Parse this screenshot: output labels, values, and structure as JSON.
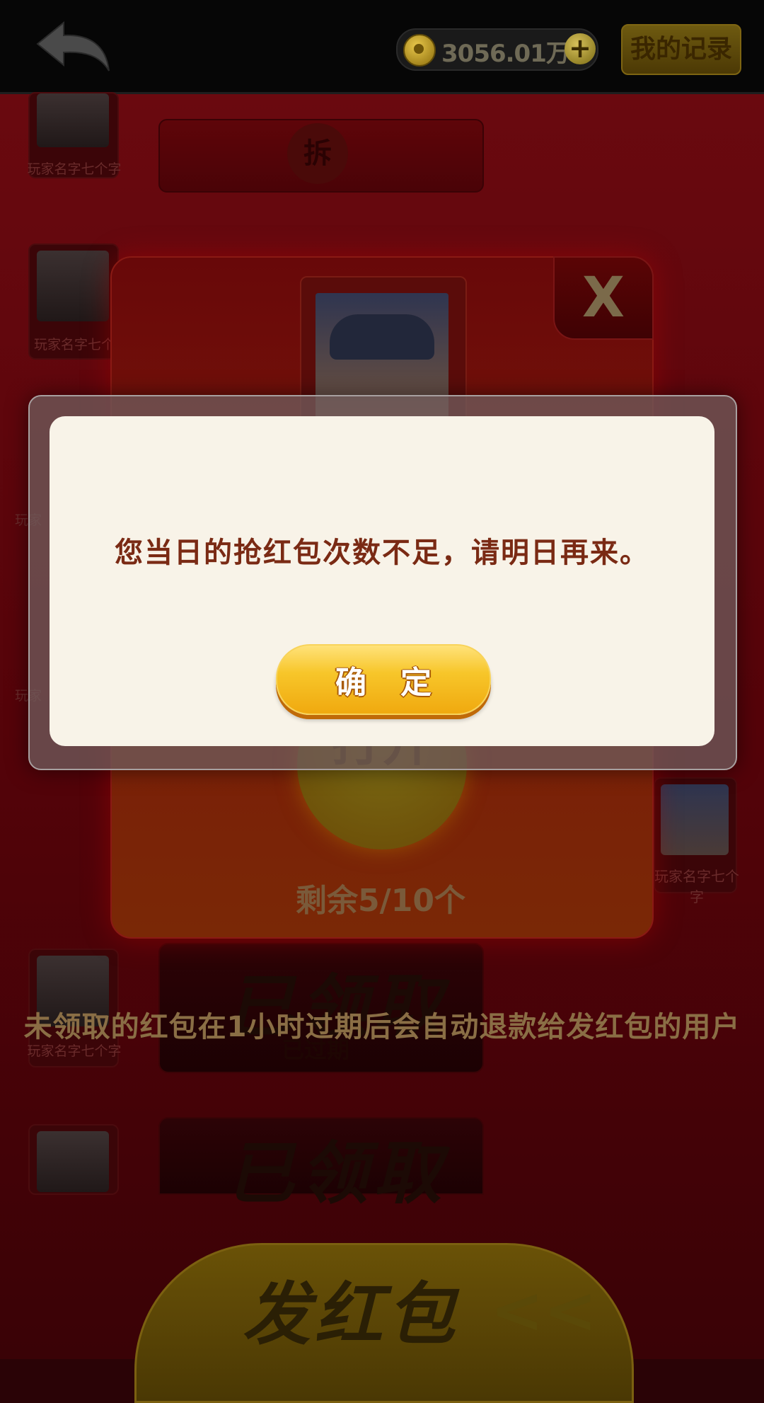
{
  "topbar": {
    "coins": "3056.01万",
    "record_label": "我的记录"
  },
  "players": {
    "name": "玩家名字七个字",
    "name_cut": "玩家名字七个",
    "name_short": "玩家",
    "name_right": "玩家名字七个字"
  },
  "envelopes": {
    "open_label": "拆",
    "status_claimed": "已领取",
    "status_expired": "已过期"
  },
  "info_line": "未领取的红包在1小时过期后会自动退款给发红包的用户",
  "send_button": {
    "label": "发红包",
    "arrow": "<<"
  },
  "popup": {
    "close_label": "X",
    "open_label": "打开",
    "remaining": "剩余5/10个"
  },
  "dialog": {
    "message": "您当日的抢红包次数不足，请明日再来。",
    "confirm_label": "确定"
  }
}
